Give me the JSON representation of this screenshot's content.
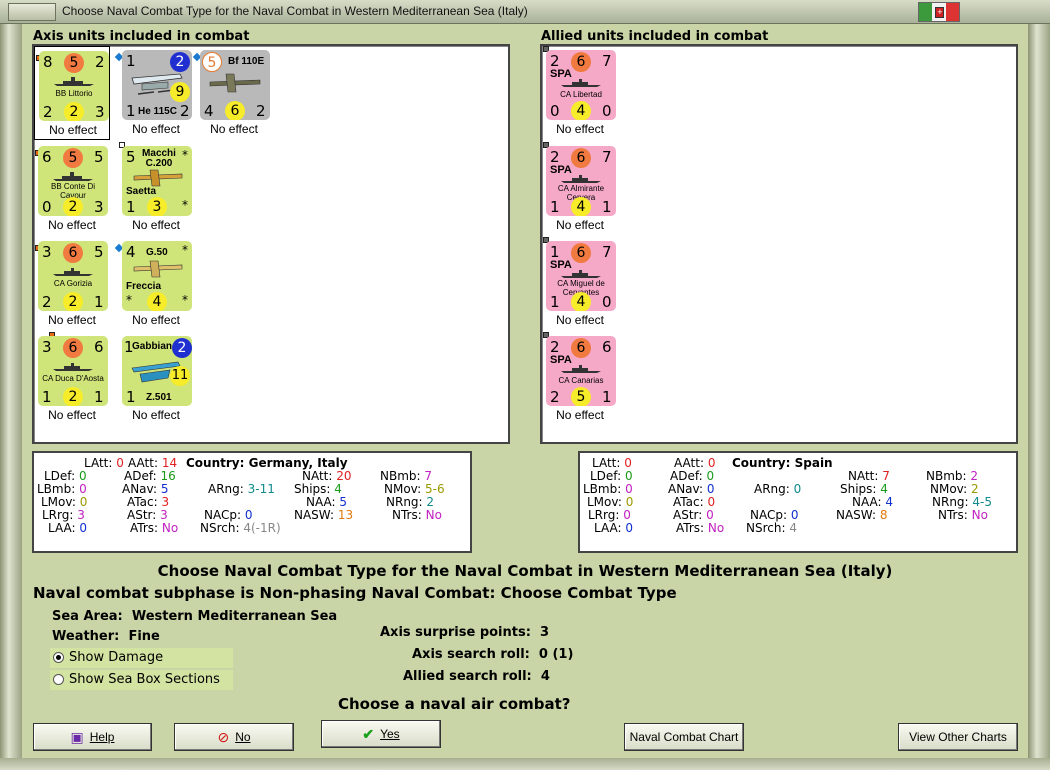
{
  "window": {
    "title": "Choose Naval Combat Type for the Naval Combat in Western Mediterranean Sea (Italy)"
  },
  "axis": {
    "heading": "Axis units included in combat",
    "units": [
      {
        "tl": "8",
        "tc": "5",
        "tr": "2",
        "bl": "2",
        "bc": "2",
        "br": "3",
        "name": "BB Littorio",
        "effect": "No effect"
      },
      {
        "tl": "1",
        "tc": "2",
        "tr": "",
        "bl": "1",
        "bc": "9",
        "br": "2",
        "name": "He 115C",
        "effect": "No effect"
      },
      {
        "tl": "5",
        "tc": "",
        "tr": "Bf 110E",
        "bl": "4",
        "bc": "6",
        "br": "2",
        "name": "Bf 110E",
        "effect": "No effect"
      },
      {
        "tl": "6",
        "tc": "5",
        "tr": "5",
        "bl": "0",
        "bc": "2",
        "br": "3",
        "name": "BB Conte Di Cavour",
        "effect": "No effect"
      },
      {
        "tl": "5",
        "tc": "Macchi C.200",
        "tr": "*",
        "bl": "1",
        "bc": "3",
        "br": "*",
        "name": "Saetta",
        "effect": "No effect"
      },
      {
        "tl": "3",
        "tc": "6",
        "tr": "5",
        "bl": "2",
        "bc": "2",
        "br": "1",
        "name": "CA Gorizia",
        "effect": "No effect"
      },
      {
        "tl": "4",
        "tc": "G.50",
        "tr": "*",
        "bl": "*",
        "bc": "4",
        "br": "*",
        "name": "Freccia",
        "effect": "No effect"
      },
      {
        "tl": "3",
        "tc": "6",
        "tr": "6",
        "bl": "1",
        "bc": "2",
        "br": "1",
        "name": "CA Duca D'Aosta",
        "effect": "No effect"
      },
      {
        "tl": "1",
        "tc": "Gabbiano",
        "tr": "2",
        "bl": "1",
        "bc": "11",
        "br": "",
        "name": "Z.501",
        "effect": "No effect"
      }
    ]
  },
  "allied": {
    "heading": "Allied units included in combat",
    "spa": "SPA",
    "units": [
      {
        "tl": "2",
        "tc": "6",
        "tr": "7",
        "bl": "0",
        "bc": "4",
        "br": "0",
        "name": "CA Libertad",
        "effect": "No effect"
      },
      {
        "tl": "2",
        "tc": "6",
        "tr": "7",
        "bl": "1",
        "bc": "4",
        "br": "1",
        "name": "CA Almirante Cervera",
        "effect": "No effect"
      },
      {
        "tl": "1",
        "tc": "6",
        "tr": "7",
        "bl": "1",
        "bc": "4",
        "br": "0",
        "name": "CA Miguel de Cervantes",
        "effect": "No effect"
      },
      {
        "tl": "2",
        "tc": "6",
        "tr": "6",
        "bl": "2",
        "bc": "5",
        "br": "1",
        "name": "CA Canarias",
        "effect": "No effect"
      }
    ]
  },
  "axis_stats": {
    "country_label": "Country:",
    "country": "Germany, Italy",
    "LAtt": "0",
    "AAtt": "14",
    "NAtt": "20",
    "NBmb": "7",
    "LDef": "0",
    "ADef": "16",
    "LBmb": "0",
    "ANav": "5",
    "ARng": "3-11",
    "Ships": "4",
    "NMov": "5-6",
    "LMov": "0",
    "ATac": "3",
    "NAA": "5",
    "NRng": "2",
    "LRrg": "3",
    "AStr": "3",
    "NACp": "0",
    "NASW": "13",
    "NTrs": "No",
    "LAA": "0",
    "ATrs": "No",
    "NSrch": "4(-1R)"
  },
  "allied_stats": {
    "country_label": "Country:",
    "country": "Spain",
    "LAtt": "0",
    "AAtt": "0",
    "NAtt": "7",
    "NBmb": "2",
    "LDef": "0",
    "ADef": "0",
    "LBmb": "0",
    "ANav": "0",
    "ARng": "0",
    "Ships": "4",
    "NMov": "2",
    "LMov": "0",
    "ATac": "0",
    "NAA": "4",
    "NRng": "4-5",
    "LRrg": "0",
    "AStr": "0",
    "NACp": "0",
    "NASW": "8",
    "NTrs": "No",
    "LAA": "0",
    "ATrs": "No",
    "NSrch": "4"
  },
  "main": {
    "title": "Choose Naval Combat Type for the Naval Combat in Western Mediterranean Sea (Italy)",
    "subtitle": "Naval combat subphase is Non-phasing Naval Combat: Choose Combat Type",
    "sea_area_label": "Sea Area:",
    "sea_area": "Western Mediterranean Sea",
    "weather_label": "Weather:",
    "weather": "Fine",
    "show_damage": "Show Damage",
    "show_sea_box": "Show Sea Box Sections",
    "axis_surprise": "Axis surprise points:",
    "axis_surprise_val": "3",
    "axis_search": "Axis search roll:",
    "axis_search_val": "0 (1)",
    "allied_search": "Allied search roll:",
    "allied_search_val": "4",
    "question": "Choose a naval air combat?"
  },
  "buttons": {
    "help": "Help",
    "no": "No",
    "yes": "Yes",
    "naval_chart": "Naval Combat Chart",
    "other_charts": "View Other Charts"
  },
  "labels": {
    "LAtt": "LAtt:",
    "AAtt": "AAtt:",
    "NAtt": "NAtt:",
    "NBmb": "NBmb:",
    "LDef": "LDef:",
    "ADef": "ADef:",
    "LBmb": "LBmb:",
    "ANav": "ANav:",
    "ARng": "ARng:",
    "Ships": "Ships:",
    "NMov": "NMov:",
    "LMov": "LMov:",
    "ATac": "ATac:",
    "NAA": "NAA:",
    "NRng": "NRng:",
    "LRrg": "LRrg:",
    "AStr": "AStr:",
    "NACp": "NACp:",
    "NASW": "NASW:",
    "NTrs": "NTrs:",
    "LAA": "LAA:",
    "ATrs": "ATrs:",
    "NSrch": "NSrch:"
  }
}
